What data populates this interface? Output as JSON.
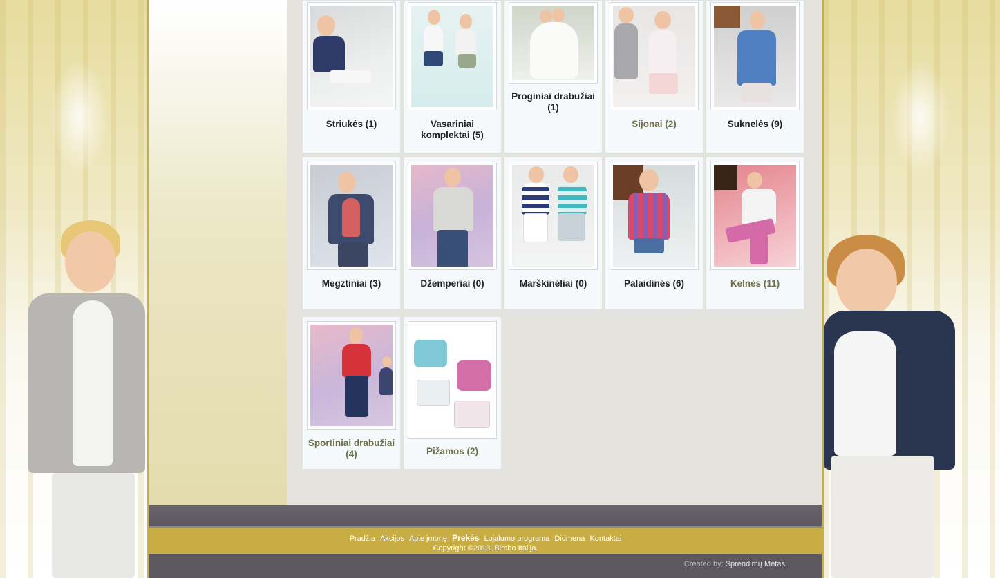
{
  "categories": [
    {
      "label": "Striukės (1)",
      "style": "dark"
    },
    {
      "label": "Vasariniai komplektai (5)",
      "style": "dark"
    },
    {
      "label": "Proginiai drabužiai (1)",
      "style": "dark"
    },
    {
      "label": "Sijonai (2)",
      "style": "olive"
    },
    {
      "label": "Suknelės (9)",
      "style": "dark"
    },
    {
      "label": "Megztiniai (3)",
      "style": "dark"
    },
    {
      "label": "Džemperiai (0)",
      "style": "dark"
    },
    {
      "label": "Marškinėliai (0)",
      "style": "dark"
    },
    {
      "label": "Palaidinės (6)",
      "style": "dark"
    },
    {
      "label": "Kelnės (11)",
      "style": "olive"
    },
    {
      "label": "Sportiniai drabužiai (4)",
      "style": "olive"
    },
    {
      "label": "Pižamos (2)",
      "style": "olive"
    }
  ],
  "footer": {
    "nav": [
      "Pradžia",
      "Akcijos",
      "Apie įmonę",
      "Prekės",
      "Lojalumo programa",
      "Didmena",
      "Kontaktai"
    ],
    "active_nav": "Prekės",
    "copyright": "Copyright ©2013. Bimbo Italija.",
    "credit_prefix": "Created by:",
    "credit_link": "Sprendimų Metas",
    "credit_suffix": "."
  },
  "colors": {
    "frame_gold": "#c7ae45",
    "footer_gray": "#5d5860",
    "label_dark": "#222222",
    "label_olive": "#6f7048"
  }
}
